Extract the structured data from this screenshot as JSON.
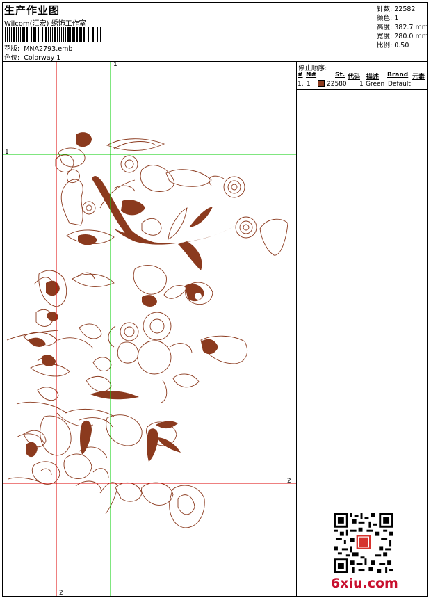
{
  "header": {
    "title": "生产作业图",
    "studio": "Wilcom(汇宏) 绣饰工作室",
    "design_label": "花版:",
    "design_value": "MNA2793.emb",
    "colorway_label": "色位:",
    "colorway_value": "Colorway 1"
  },
  "stats": [
    {
      "label": "针数:",
      "value": "22582"
    },
    {
      "label": "颜色:",
      "value": "1"
    },
    {
      "label": "高度:",
      "value": "382.7 mm"
    },
    {
      "label": "宽度:",
      "value": "280.0 mm"
    },
    {
      "label": "比例:",
      "value": "0.50"
    }
  ],
  "stop_sequence": {
    "label": "停止顺序:",
    "columns": [
      "#",
      "N#",
      "St.",
      "代码",
      "描述",
      "Brand",
      "元素"
    ],
    "rows": [
      {
        "index": "1.",
        "needle": "1",
        "stitches": "22580",
        "code": "1",
        "description": "Green",
        "brand": "Default",
        "color": "#8B3A1E"
      }
    ]
  },
  "guides": {
    "green_v": "1",
    "green_h": "1",
    "red_h": "2",
    "red_v": "2"
  },
  "colors": {
    "thread": "#8B3A1E",
    "guide_green": "#00CC00",
    "guide_red": "#DD0000"
  },
  "watermark": "6xiu.com"
}
